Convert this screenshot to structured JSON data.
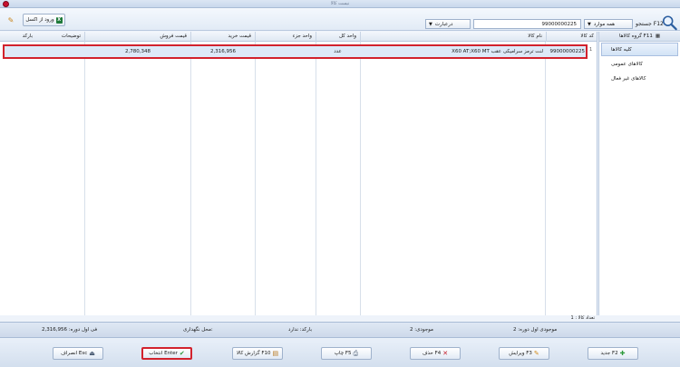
{
  "window": {
    "title": "نیست کالا"
  },
  "toolbar": {
    "import_excel_label": "ورود از اکسل",
    "search_label": "جستجو F12",
    "field_select": "همه موارد",
    "search_value": "99000000225",
    "mode_select": "درعبارت"
  },
  "sidebar": {
    "header": "گروه کالاها F11",
    "items": [
      {
        "label": "کلیه کالاها"
      },
      {
        "label": "کالاهای عمومی"
      },
      {
        "label": "کالاهای غیر فعال"
      }
    ]
  },
  "table": {
    "columns": [
      "کد کالا",
      "نام کالا",
      "واحد کل",
      "واحد جزء",
      "قیمت خرید",
      "قیمت فروش",
      "توضیحات",
      "بارکد"
    ],
    "rows": [
      {
        "code": "99000000225",
        "name": "X60 AT;X60 MT لنت ترمز سرامیکی عقب",
        "unit_total": "عدد",
        "unit_part": "",
        "buy_price": "2,316,956",
        "sell_price": "2,780,348",
        "description": "",
        "barcode": ""
      }
    ],
    "row_number": "1"
  },
  "summary": {
    "count": "تعداد کالا : 1",
    "stock_initial": "موجودی اول دوره: 2",
    "stock": "موجودی: 2",
    "barcode": "بارکد: ندارد",
    "location": "محل نگهداری:",
    "price_initial": "فی اول دوره: 2,316,956"
  },
  "actions": {
    "new": "جدید F2",
    "edit": "ویرایش F3",
    "delete": "حذف F4",
    "print": "چاپ F5",
    "report": "گزارش کالا F10",
    "select": "انتخاب Enter",
    "cancel": "انصراف Esc"
  },
  "colors": {
    "highlight": "#d2222d",
    "row_selected": "#dde9f8",
    "chrome": "#dfe8f4"
  }
}
